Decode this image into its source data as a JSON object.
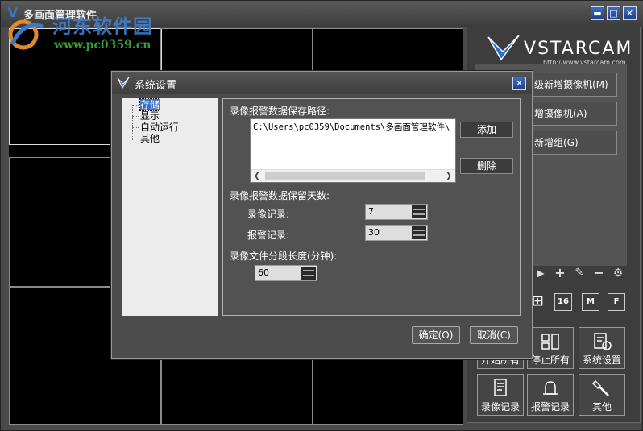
{
  "window": {
    "title": "多画面管理软件",
    "buttons": {
      "minimize": "▬",
      "maximize": "□",
      "close": "✕"
    }
  },
  "watermark": {
    "text": "河东软件园",
    "url": "www.pc0359.cn"
  },
  "brand": {
    "name": "VSTARCAM",
    "url": "http://www.vstarcam.com"
  },
  "side_buttons": [
    {
      "label": "搜索新增摄像机(M)",
      "visible_label": "级新增摄像机(M)"
    },
    {
      "label": "增摄像机(A)"
    },
    {
      "label": "新增组(G)"
    }
  ],
  "layout_buttons": [
    "⊞",
    "16",
    "M",
    "F"
  ],
  "big_buttons": {
    "start_all": "开始所有",
    "stop_all": "停止所有",
    "system_settings": "系统设置",
    "record_log": "录像记录",
    "alarm_log": "报警记录",
    "other": "其他"
  },
  "dialog": {
    "title": "系统设置",
    "close": "✕",
    "tree": [
      "存储",
      "显示",
      "自动运行",
      "其他"
    ],
    "storage": {
      "path_label": "录像报警数据保存路径:",
      "path_value": "C:\\Users\\pc0359\\Documents\\多画面管理软件\\",
      "add": "添加",
      "delete": "删除",
      "retention_label": "录像报警数据保留天数:",
      "record_label": "录像记录:",
      "record_days": "7",
      "alarm_label": "报警记录:",
      "alarm_days": "30",
      "segment_label": "录像文件分段长度(分钟):",
      "segment_minutes": "60"
    },
    "ok": "确定(O)",
    "cancel": "取消(C)"
  }
}
